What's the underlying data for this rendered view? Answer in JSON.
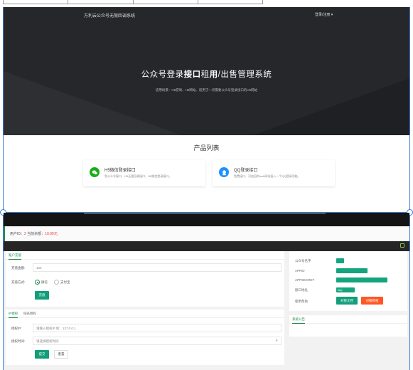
{
  "header": {
    "brand": "万利云公众号无限回调系统",
    "login_menu": "登录/注册 ▾"
  },
  "hero": {
    "title_part1": "公众号登录",
    "title_bold1": "接口",
    "title_part2": "租",
    "title_bold2": "用",
    "title_part3": "/出售管理系统",
    "subtitle": "适用场景：H5游戏、H5网站、适用于一切需要公众号登录接口的H5网站"
  },
  "products": {
    "heading": "产品列表",
    "cards": [
      {
        "title": "H5微信登录接口",
        "desc": "免公众号接口、H5无限回调接口、H5微信登录接口。",
        "icon": "wechat-icon",
        "color": "#1aad19"
      },
      {
        "title": "QQ登录接口",
        "desc": "免费接口、可由回的web网站接入一个QQ登录功能。",
        "icon": "qq-icon",
        "color": "#1e90ff"
      }
    ]
  },
  "account": {
    "label": "用户ID：",
    "user_id": "2",
    "balance_label": " 当前余额：",
    "balance": "10.00元"
  },
  "recharge": {
    "tab": "账户充值",
    "amount_label": "充值金额:",
    "amount_value": "100",
    "method_label": "充值方式:",
    "method_options": [
      "微信",
      "支付宝"
    ],
    "submit": "充值"
  },
  "auth": {
    "tabs": [
      "IP授权",
      "域名授权"
    ],
    "ip_label": "授权IP:",
    "ip_placeholder": "请输入授权IP 如：127.0.0.1",
    "time_label": "授权时间:",
    "time_placeholder": "请选择授权时间",
    "submit": "提交",
    "reset": "重置"
  },
  "info": {
    "rows": [
      "公众号名字",
      "APPID",
      "APPSECRET",
      "接口地址",
      "使用帮助"
    ],
    "url_prefix": "http",
    "doc_button": "对接文档",
    "tutorial_button": "对接教程"
  },
  "notice": {
    "title": "系统公告"
  },
  "colors": {
    "accent_green": "#1e8a4c",
    "button_green": "#129e7a",
    "orange": "#ff5722",
    "frame_blue": "#3a7bd5"
  }
}
